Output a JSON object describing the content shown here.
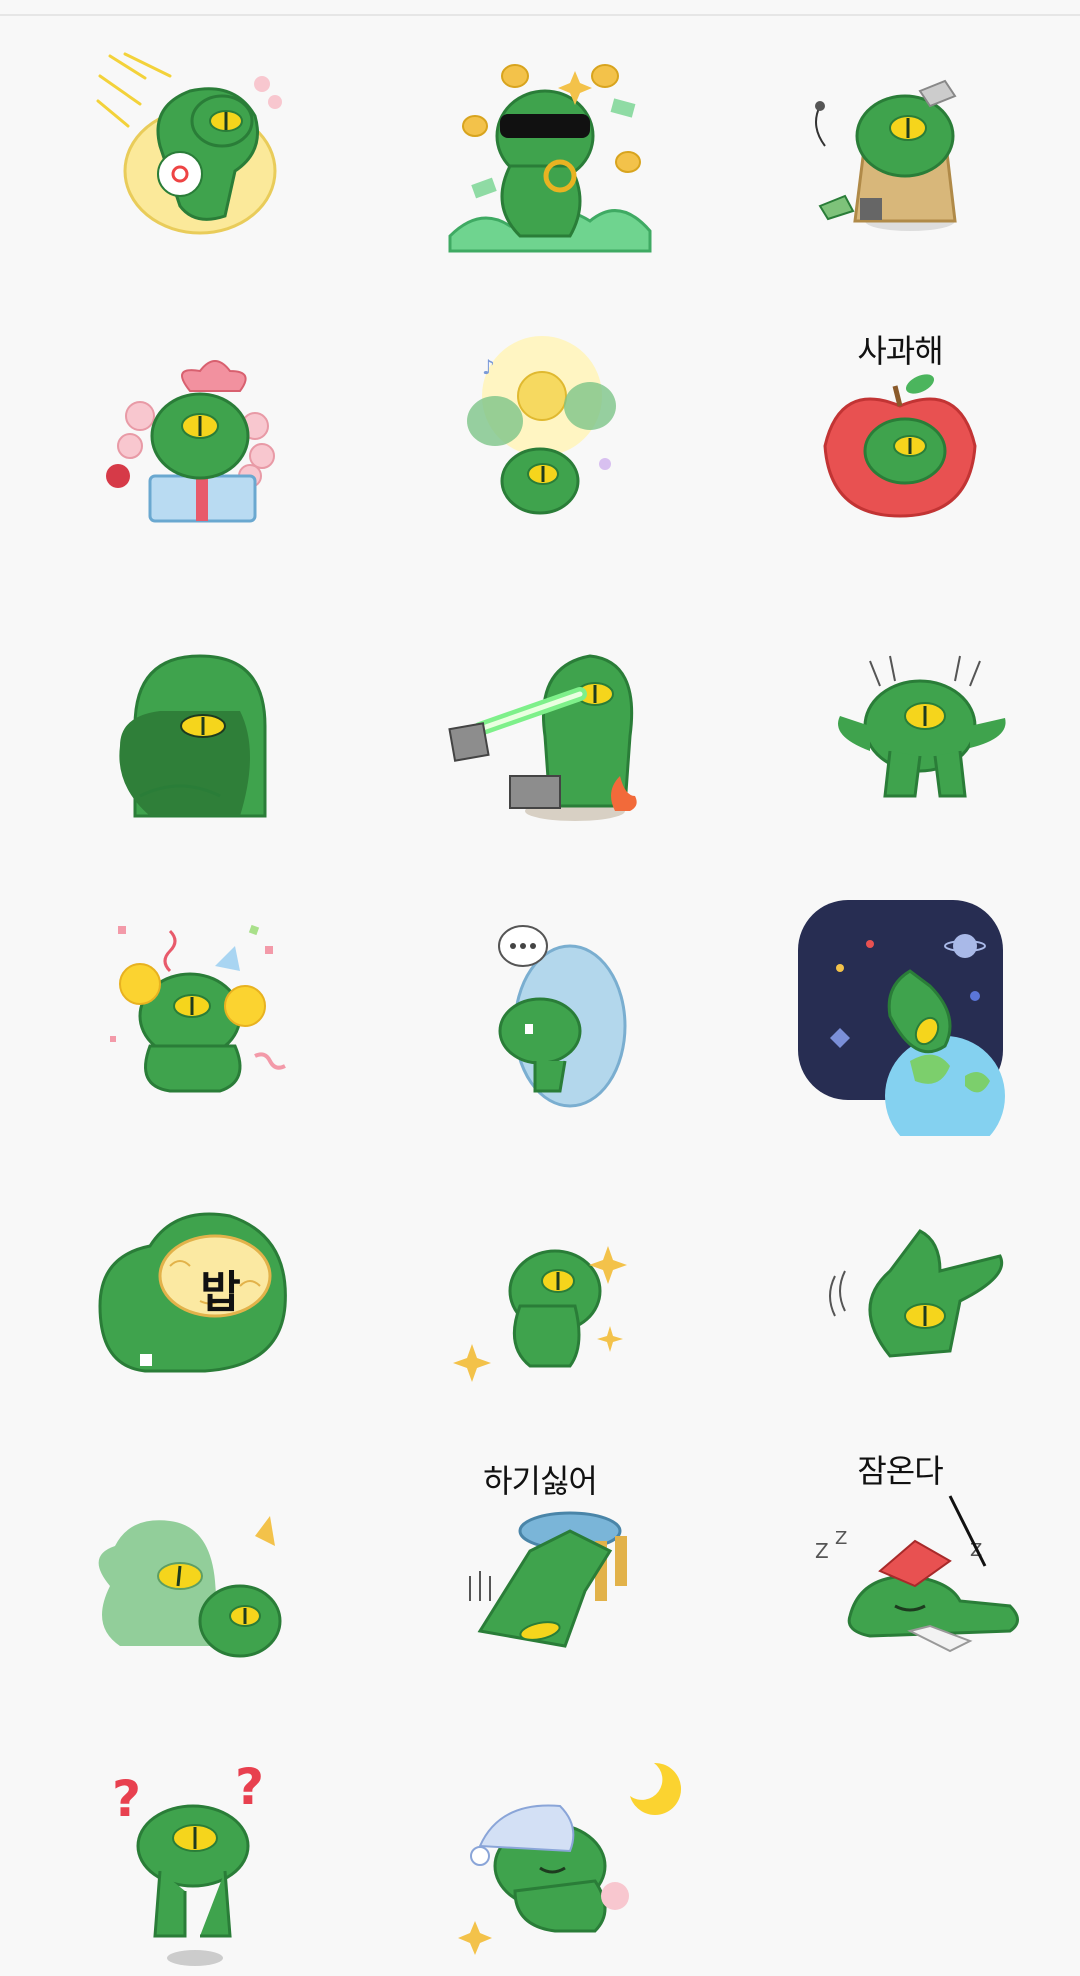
{
  "stickers": [
    {
      "name": "sticker-coffee-float",
      "icon": "coffee-cup-icon",
      "caption": ""
    },
    {
      "name": "sticker-rich-sunglasses",
      "icon": "sunglasses-icon",
      "caption": ""
    },
    {
      "name": "sticker-hobo-wanderer",
      "icon": "bindle-icon",
      "caption": ""
    },
    {
      "name": "sticker-gift-box",
      "icon": "gift-box-icon",
      "caption": ""
    },
    {
      "name": "sticker-shine-ghosts",
      "icon": "sun-icon",
      "caption": ""
    },
    {
      "name": "sticker-apology-apple",
      "icon": "apple-icon",
      "caption": "사과해"
    },
    {
      "name": "sticker-grumpy-hood",
      "icon": "hood-icon",
      "caption": ""
    },
    {
      "name": "sticker-laser-eyes",
      "icon": "laser-icon",
      "caption": ""
    },
    {
      "name": "sticker-surprised",
      "icon": "surprise-icon",
      "caption": ""
    },
    {
      "name": "sticker-party-pompoms",
      "icon": "pompom-icon",
      "caption": ""
    },
    {
      "name": "sticker-speechless-hug",
      "icon": "speech-bubble-icon",
      "caption": ""
    },
    {
      "name": "sticker-space-earth",
      "icon": "planet-icon",
      "caption": ""
    },
    {
      "name": "sticker-brain-bap",
      "icon": "brain-icon",
      "caption": "밥"
    },
    {
      "name": "sticker-sparkle-pose",
      "icon": "sparkle-icon",
      "caption": ""
    },
    {
      "name": "sticker-waving",
      "icon": "wave-icon",
      "caption": ""
    },
    {
      "name": "sticker-ghost-shadow",
      "icon": "ghost-icon",
      "caption": ""
    },
    {
      "name": "sticker-dont-want",
      "icon": "stool-icon",
      "caption": "하기싫어"
    },
    {
      "name": "sticker-sleepy-book",
      "icon": "book-icon",
      "caption": "잠온다"
    },
    {
      "name": "sticker-question",
      "icon": "question-mark-icon",
      "caption": ""
    },
    {
      "name": "sticker-sleeping-nightcap",
      "icon": "moon-icon",
      "caption": ""
    }
  ],
  "colors": {
    "body": "#3fa34d",
    "outline": "#2a7d38",
    "eye": "#f5d51c",
    "background": "#f8f8f8"
  }
}
